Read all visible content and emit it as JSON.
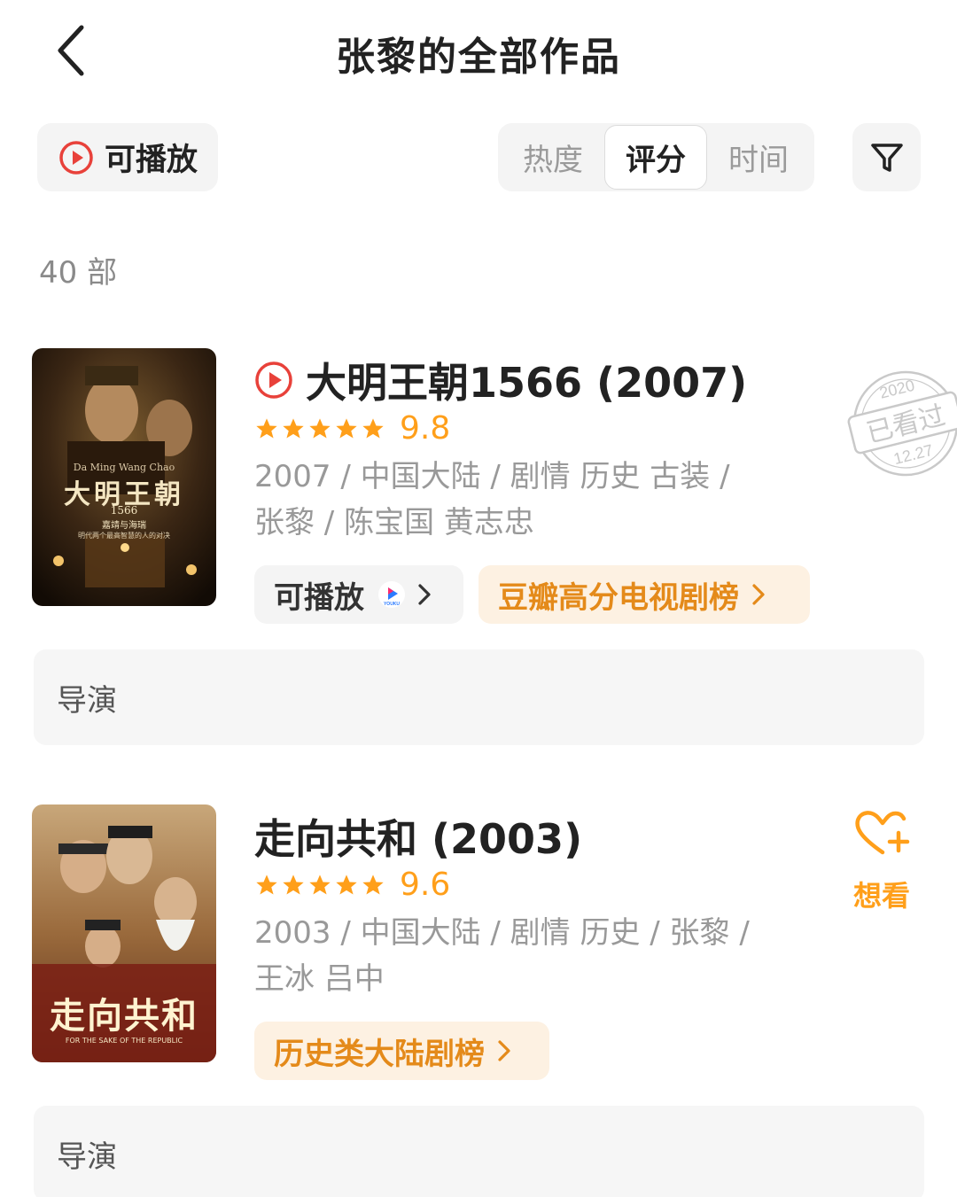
{
  "header": {
    "title": "张黎的全部作品"
  },
  "filters": {
    "playable_label": "可播放",
    "sort_tabs": [
      "热度",
      "评分",
      "时间"
    ],
    "active_sort": "评分"
  },
  "count_text": "40 部",
  "works": [
    {
      "title": "大明王朝1566 (2007)",
      "playable": true,
      "stars": 5,
      "score": "9.8",
      "meta_line1": "2007 / 中国大陆 / 剧情 历史 古装 /",
      "meta_line2": "张黎 / 陈宝国 黄志忠",
      "play_chip": "可播放",
      "play_platform_icon": "youku-icon",
      "play_platform_text": "YOUKU",
      "rank_chip": "豆瓣高分电视剧榜",
      "director_label": "导演",
      "poster": {
        "latin_title": "Da Ming Wang Chao",
        "cn_title": "大明王朝",
        "subtitle": "1566",
        "tagline": "嘉靖与海瑞",
        "blurb": "明代两个最高智慧的人的对决"
      },
      "stamp": {
        "year": "2020",
        "text": "已看过",
        "date": "12.27"
      }
    },
    {
      "title": "走向共和 (2003)",
      "playable": false,
      "stars": 5,
      "score": "9.6",
      "meta_line1": "2003 / 中国大陆 / 剧情 历史 / 张黎 /",
      "meta_line2": "王冰 吕中",
      "rank_chip": "历史类大陆剧榜",
      "director_label": "导演",
      "want_label": "想看",
      "poster": {
        "cn_title": "走向共和",
        "en_title": "FOR THE SAKE OF THE REPUBLIC"
      }
    }
  ],
  "colors": {
    "accent_orange": "#ff9f1a",
    "play_red": "#e8413a",
    "chip_orange_bg": "#fdf1e2"
  }
}
